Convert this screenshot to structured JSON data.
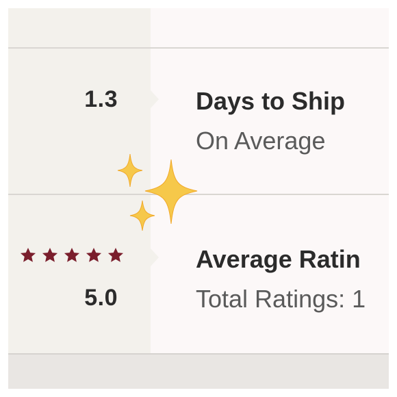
{
  "shipping": {
    "value": "1.3",
    "title": "Days to Ship",
    "subtitle": "On Average"
  },
  "ratings": {
    "value": "5.0",
    "stars": 5,
    "star_color": "#7a1e2c",
    "title": "Average Ratin",
    "subtitle": "Total Ratings: 1"
  },
  "theme": {
    "left_panel_bg": "#f3f1ec",
    "card_bg": "#fcf8f8",
    "sparkle_color": "#f6c84a"
  },
  "icons": [
    "star-icon",
    "sparkles-icon"
  ]
}
